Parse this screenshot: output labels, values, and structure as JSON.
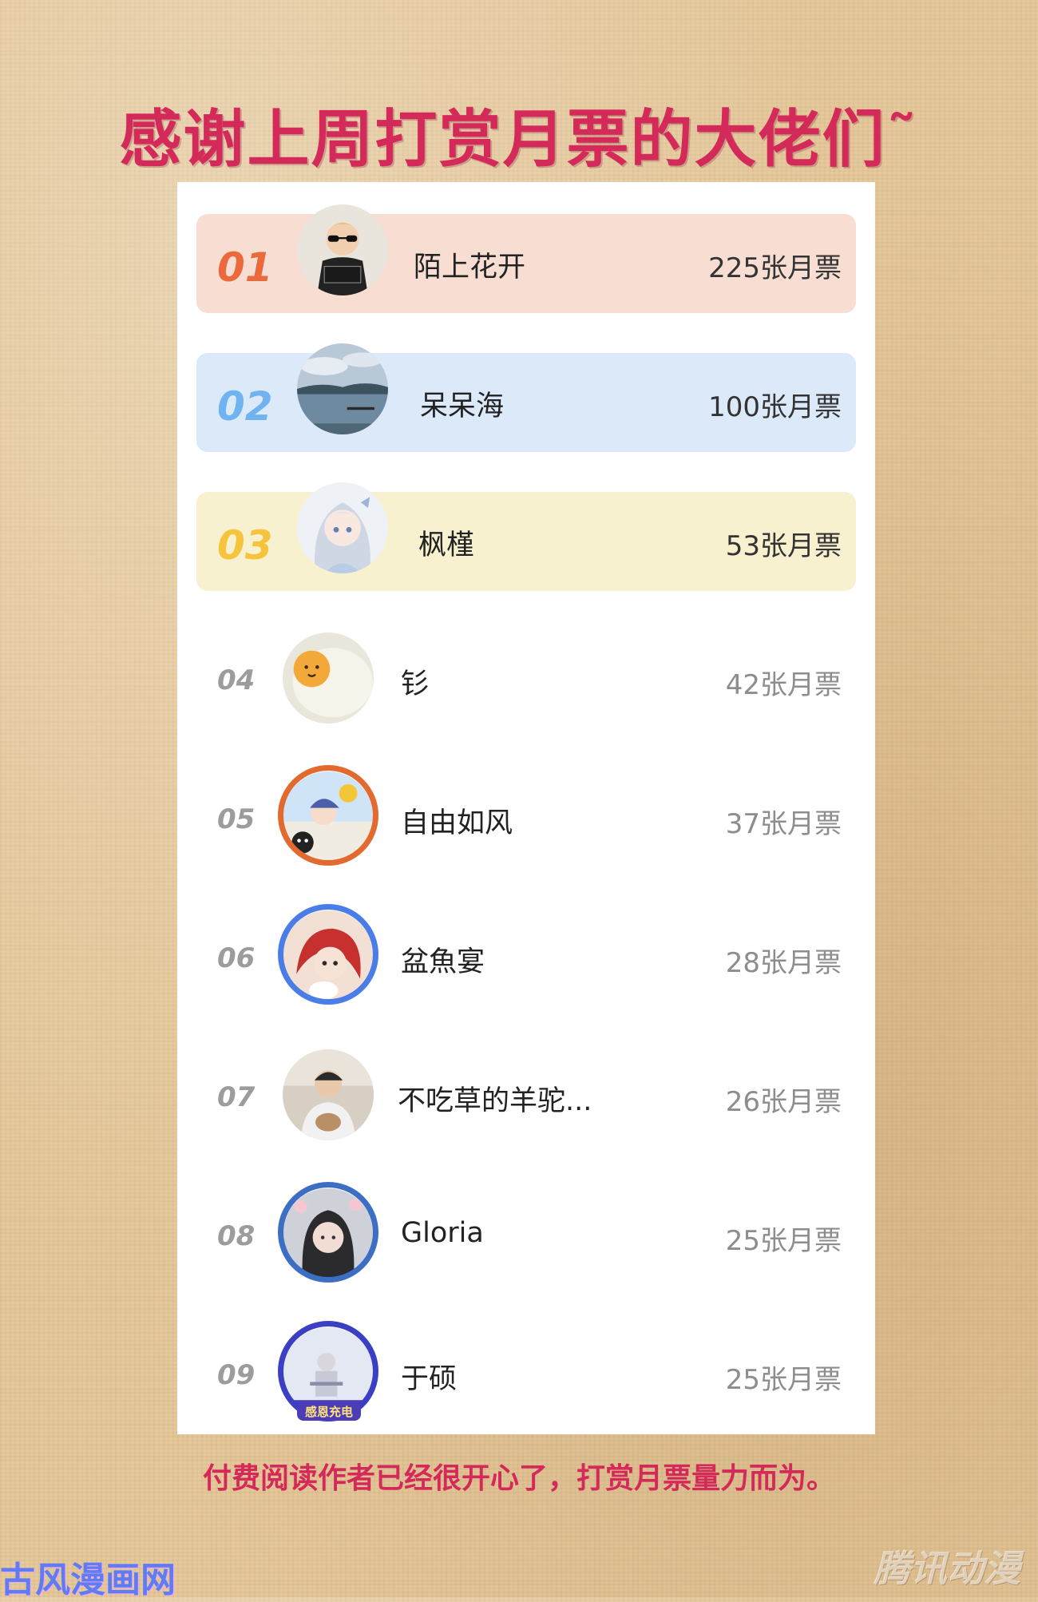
{
  "title": "感谢上周打赏月票的大佬们˜",
  "colors": {
    "title": "#d42a5a",
    "row1_bg": "#f7ddd2",
    "row2_bg": "#dce9f9",
    "row3_bg": "#f8f1cf",
    "rank1": "#ea6a3c",
    "rank2": "#6fb3f0",
    "rank3": "#f5c43c",
    "rank_other": "#9c9c9c"
  },
  "ranking": [
    {
      "rank": "01",
      "name": "陌上花开",
      "votes": "225张月票",
      "avatar_icon": "sunglasses-kid-avatar"
    },
    {
      "rank": "02",
      "name": "呆呆海",
      "votes": "100张月票",
      "avatar_icon": "lake-landscape-avatar"
    },
    {
      "rank": "03",
      "name": "枫槿",
      "votes": "53张月票",
      "avatar_icon": "anime-girl-avatar"
    },
    {
      "rank": "04",
      "name": "钐",
      "votes": "42张月票",
      "avatar_icon": "egg-avatar"
    },
    {
      "rank": "05",
      "name": "自由如风",
      "votes": "37张月票",
      "avatar_icon": "anime-frame-avatar"
    },
    {
      "rank": "06",
      "name": "盆魚宴",
      "votes": "28张月票",
      "avatar_icon": "red-hair-anime-avatar"
    },
    {
      "rank": "07",
      "name": "不吃草的羊驼...",
      "votes": "26张月票",
      "avatar_icon": "person-photo-avatar"
    },
    {
      "rank": "08",
      "name": "Gloria",
      "votes": "25张月票",
      "avatar_icon": "flower-frame-avatar"
    },
    {
      "rank": "09",
      "name": "于硕",
      "votes": "25张月票",
      "avatar_icon": "thanks-frame-avatar"
    }
  ],
  "avatar_badge_text": "感恩充电",
  "footer": "付费阅读作者已经很开心了，打赏月票量力而为。",
  "watermark_left": "古风漫画网",
  "watermark_right": "腾讯动漫"
}
